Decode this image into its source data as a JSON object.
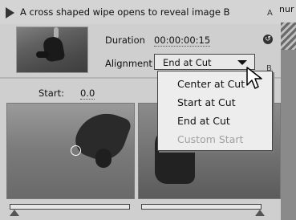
{
  "header": {
    "description": "A cross shaped wipe opens to reveal image B",
    "track_a": "A",
    "right_fragment": "nur"
  },
  "settings": {
    "duration_label": "Duration",
    "duration_value": "00:00:00:15",
    "alignment_label": "Alignment",
    "alignment_value": "End at Cut",
    "track_b": "B"
  },
  "start": {
    "label": "Start:",
    "value": "0.0"
  },
  "alignment_menu": {
    "items": [
      "Center at Cut",
      "Start at Cut",
      "End at Cut",
      "Custom Start"
    ],
    "disabled_item": "Custom Start"
  },
  "icons": {
    "play": "play-icon",
    "reset": "reset-icon",
    "dropdown_arrow": "chevron-down-icon",
    "pointer": "mouse-pointer-icon"
  }
}
